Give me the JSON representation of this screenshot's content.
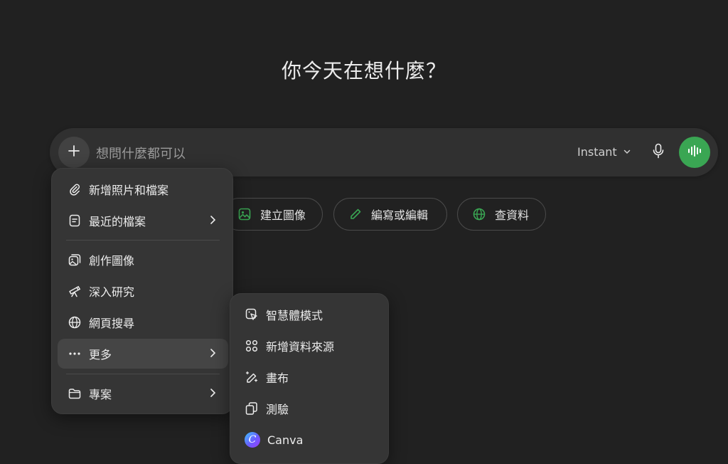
{
  "headline": "你今天在想什麼？",
  "composer": {
    "placeholder": "想問什麼都可以",
    "model": "Instant"
  },
  "chips": [
    {
      "label": "建立圖像",
      "icon": "image-icon"
    },
    {
      "label": "編寫或編輯",
      "icon": "pencil-icon"
    },
    {
      "label": "查資料",
      "icon": "globe-icon"
    }
  ],
  "menu": {
    "items": [
      {
        "label": "新增照片和檔案",
        "icon": "paperclip-icon"
      },
      {
        "label": "最近的檔案",
        "icon": "file-icon"
      },
      {
        "label": "創作圖像",
        "icon": "images-icon"
      },
      {
        "label": "深入研究",
        "icon": "telescope-icon"
      },
      {
        "label": "網頁搜尋",
        "icon": "globe-icon"
      },
      {
        "label": "更多",
        "icon": "more-icon"
      },
      {
        "label": "專案",
        "icon": "folder-icon"
      }
    ]
  },
  "submenu": {
    "items": [
      {
        "label": "智慧體模式",
        "icon": "agent-icon"
      },
      {
        "label": "新增資料來源",
        "icon": "apps-icon"
      },
      {
        "label": "畫布",
        "icon": "canvas-icon"
      },
      {
        "label": "測驗",
        "icon": "cards-icon"
      },
      {
        "label": "Canva",
        "icon": "canva-logo"
      }
    ]
  },
  "colors": {
    "background": "#212121",
    "composer": "#303030",
    "menu": "#353535",
    "accent_green": "#3aa653"
  }
}
